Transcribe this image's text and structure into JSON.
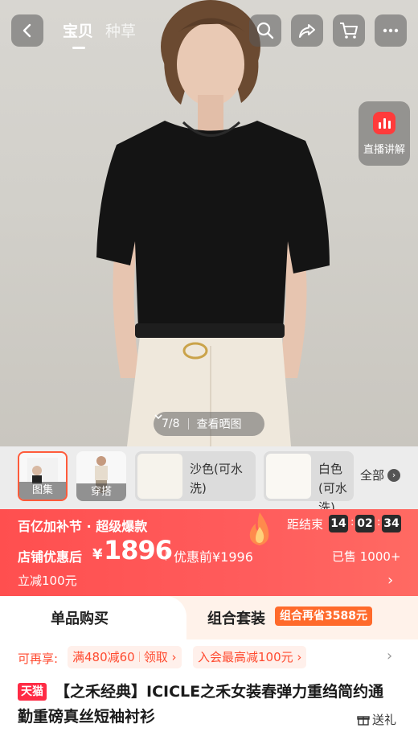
{
  "header": {
    "tabs": [
      {
        "label": "宝贝",
        "active": true
      },
      {
        "label": "种草",
        "active": false
      }
    ],
    "icons": [
      "back-icon",
      "search-icon",
      "share-icon",
      "cart-icon",
      "more-icon"
    ]
  },
  "live": {
    "label": "直播讲解"
  },
  "gallery": {
    "counter": "7/8",
    "view_photos": "查看晒图",
    "thumbnails": [
      {
        "caption": "图集",
        "selected": true
      },
      {
        "caption": "穿搭",
        "selected": false
      }
    ],
    "color_options": [
      {
        "label": "沙色(可水洗)"
      },
      {
        "label": "白色(可水洗)"
      }
    ],
    "all_label": "全部"
  },
  "promo": {
    "title": "百亿加补节 · 超级爆款",
    "countdown_label": "距结束",
    "countdown": [
      "14",
      "02",
      "34"
    ],
    "price_label": "店铺优惠后",
    "currency": "¥",
    "price": "1896",
    "before_price": "优惠前¥1996",
    "sold": "已售 1000+",
    "instant_discount": "立减100元",
    "colors": {
      "banner": "#ff5252",
      "timer_box": "#2a2a2a"
    }
  },
  "purchase_tabs": {
    "single": "单品购买",
    "bundle": "组合套装",
    "bundle_badge": "组合再省3588元"
  },
  "coupons": {
    "label": "可再享:",
    "items": [
      {
        "text": "满480减60",
        "action": "领取"
      },
      {
        "text": "入会最高减100元"
      }
    ]
  },
  "product": {
    "store_badge": "天猫",
    "title": "【之禾经典】ICICLE之禾女装春弹力重绉简约通勤重磅真丝短袖衬衫",
    "gift_label": "送礼"
  }
}
